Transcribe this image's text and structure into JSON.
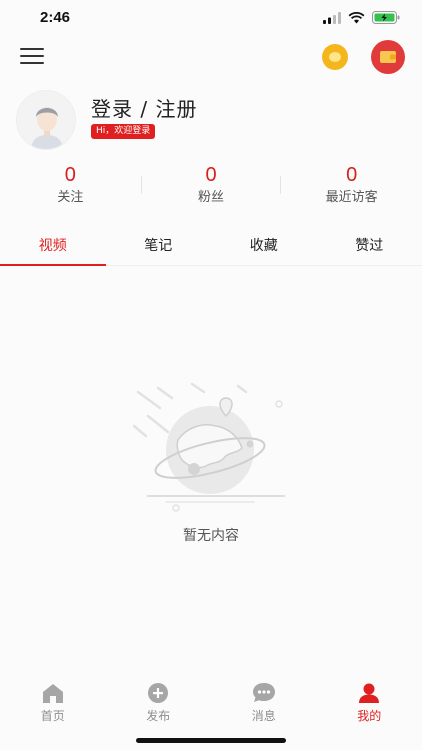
{
  "status_bar": {
    "time": "2:46"
  },
  "profile": {
    "login_title": "登录 / 注册",
    "hi_badge": "Hi，欢迎登录"
  },
  "stats": [
    {
      "value": "0",
      "label": "关注"
    },
    {
      "value": "0",
      "label": "粉丝"
    },
    {
      "value": "0",
      "label": "最近访客"
    }
  ],
  "tabs": [
    {
      "label": "视频",
      "active": true
    },
    {
      "label": "笔记"
    },
    {
      "label": "收藏"
    },
    {
      "label": "赞过"
    }
  ],
  "empty_state": {
    "text": "暂无内容"
  },
  "bottom_nav": [
    {
      "label": "首页",
      "icon": "home-icon"
    },
    {
      "label": "发布",
      "icon": "plus-circle-icon"
    },
    {
      "label": "消息",
      "icon": "chat-bubble-icon"
    },
    {
      "label": "我的",
      "icon": "user-icon",
      "active": true
    }
  ],
  "colors": {
    "accent": "#e02020",
    "coin": "#f5b61d",
    "wallet": "#e03a3a"
  }
}
